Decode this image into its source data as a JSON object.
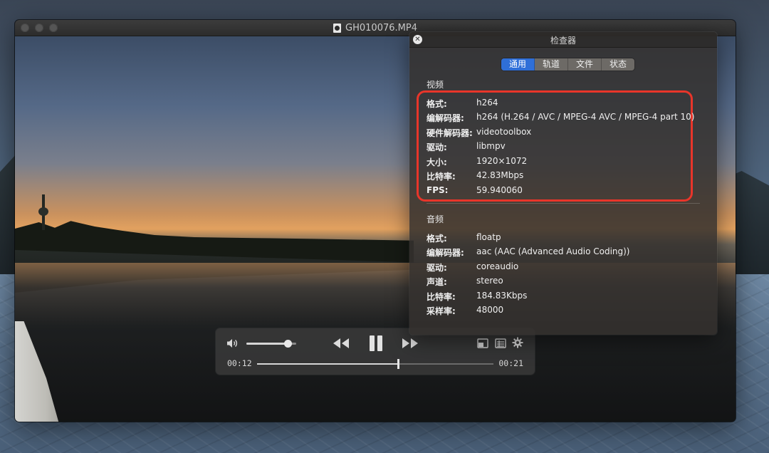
{
  "window": {
    "title": "GH010076.MP4"
  },
  "player": {
    "time_current": "00:12",
    "time_total": "00:21",
    "volume_level": 0.83,
    "seek_progress": 0.595
  },
  "inspector": {
    "title": "检查器",
    "tabs": [
      {
        "label": "通用",
        "active": true
      },
      {
        "label": "轨道",
        "active": false
      },
      {
        "label": "文件",
        "active": false
      },
      {
        "label": "状态",
        "active": false
      }
    ],
    "video": {
      "heading": "视频",
      "rows": [
        {
          "key": "格式:",
          "value": "h264"
        },
        {
          "key": "编解码器:",
          "value": "h264 (H.264 / AVC / MPEG-4 AVC / MPEG-4 part 10)"
        },
        {
          "key": "硬件解码器:",
          "value": "videotoolbox"
        },
        {
          "key": "驱动:",
          "value": "libmpv"
        },
        {
          "key": "大小:",
          "value": "1920×1072"
        },
        {
          "key": "比特率:",
          "value": "42.83Mbps"
        },
        {
          "key": "FPS:",
          "value": "59.940060"
        }
      ]
    },
    "audio": {
      "heading": "音频",
      "rows": [
        {
          "key": "格式:",
          "value": "floatp"
        },
        {
          "key": "编解码器:",
          "value": "aac (AAC (Advanced Audio Coding))"
        },
        {
          "key": "驱动:",
          "value": "coreaudio"
        },
        {
          "key": "声道:",
          "value": "stereo"
        },
        {
          "key": "比特率:",
          "value": "184.83Kbps"
        },
        {
          "key": "采样率:",
          "value": "48000"
        }
      ]
    }
  },
  "colors": {
    "accent": "#2f6fd8",
    "highlight": "#e8352a"
  }
}
